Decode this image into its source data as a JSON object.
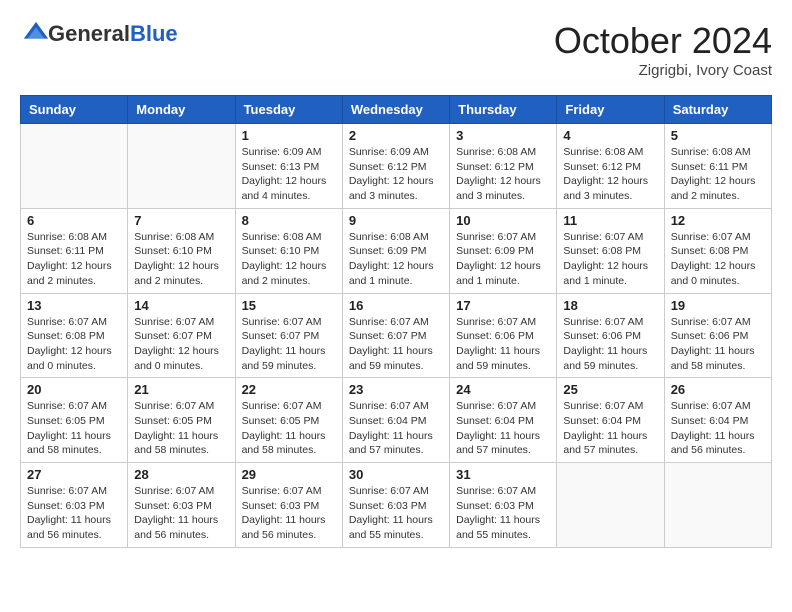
{
  "header": {
    "logo_general": "General",
    "logo_blue": "Blue",
    "month_title": "October 2024",
    "location": "Zigrigbi, Ivory Coast"
  },
  "days_of_week": [
    "Sunday",
    "Monday",
    "Tuesday",
    "Wednesday",
    "Thursday",
    "Friday",
    "Saturday"
  ],
  "weeks": [
    [
      {
        "day": "",
        "detail": ""
      },
      {
        "day": "",
        "detail": ""
      },
      {
        "day": "1",
        "detail": "Sunrise: 6:09 AM\nSunset: 6:13 PM\nDaylight: 12 hours and 4 minutes."
      },
      {
        "day": "2",
        "detail": "Sunrise: 6:09 AM\nSunset: 6:12 PM\nDaylight: 12 hours and 3 minutes."
      },
      {
        "day": "3",
        "detail": "Sunrise: 6:08 AM\nSunset: 6:12 PM\nDaylight: 12 hours and 3 minutes."
      },
      {
        "day": "4",
        "detail": "Sunrise: 6:08 AM\nSunset: 6:12 PM\nDaylight: 12 hours and 3 minutes."
      },
      {
        "day": "5",
        "detail": "Sunrise: 6:08 AM\nSunset: 6:11 PM\nDaylight: 12 hours and 2 minutes."
      }
    ],
    [
      {
        "day": "6",
        "detail": "Sunrise: 6:08 AM\nSunset: 6:11 PM\nDaylight: 12 hours and 2 minutes."
      },
      {
        "day": "7",
        "detail": "Sunrise: 6:08 AM\nSunset: 6:10 PM\nDaylight: 12 hours and 2 minutes."
      },
      {
        "day": "8",
        "detail": "Sunrise: 6:08 AM\nSunset: 6:10 PM\nDaylight: 12 hours and 2 minutes."
      },
      {
        "day": "9",
        "detail": "Sunrise: 6:08 AM\nSunset: 6:09 PM\nDaylight: 12 hours and 1 minute."
      },
      {
        "day": "10",
        "detail": "Sunrise: 6:07 AM\nSunset: 6:09 PM\nDaylight: 12 hours and 1 minute."
      },
      {
        "day": "11",
        "detail": "Sunrise: 6:07 AM\nSunset: 6:08 PM\nDaylight: 12 hours and 1 minute."
      },
      {
        "day": "12",
        "detail": "Sunrise: 6:07 AM\nSunset: 6:08 PM\nDaylight: 12 hours and 0 minutes."
      }
    ],
    [
      {
        "day": "13",
        "detail": "Sunrise: 6:07 AM\nSunset: 6:08 PM\nDaylight: 12 hours and 0 minutes."
      },
      {
        "day": "14",
        "detail": "Sunrise: 6:07 AM\nSunset: 6:07 PM\nDaylight: 12 hours and 0 minutes."
      },
      {
        "day": "15",
        "detail": "Sunrise: 6:07 AM\nSunset: 6:07 PM\nDaylight: 11 hours and 59 minutes."
      },
      {
        "day": "16",
        "detail": "Sunrise: 6:07 AM\nSunset: 6:07 PM\nDaylight: 11 hours and 59 minutes."
      },
      {
        "day": "17",
        "detail": "Sunrise: 6:07 AM\nSunset: 6:06 PM\nDaylight: 11 hours and 59 minutes."
      },
      {
        "day": "18",
        "detail": "Sunrise: 6:07 AM\nSunset: 6:06 PM\nDaylight: 11 hours and 59 minutes."
      },
      {
        "day": "19",
        "detail": "Sunrise: 6:07 AM\nSunset: 6:06 PM\nDaylight: 11 hours and 58 minutes."
      }
    ],
    [
      {
        "day": "20",
        "detail": "Sunrise: 6:07 AM\nSunset: 6:05 PM\nDaylight: 11 hours and 58 minutes."
      },
      {
        "day": "21",
        "detail": "Sunrise: 6:07 AM\nSunset: 6:05 PM\nDaylight: 11 hours and 58 minutes."
      },
      {
        "day": "22",
        "detail": "Sunrise: 6:07 AM\nSunset: 6:05 PM\nDaylight: 11 hours and 58 minutes."
      },
      {
        "day": "23",
        "detail": "Sunrise: 6:07 AM\nSunset: 6:04 PM\nDaylight: 11 hours and 57 minutes."
      },
      {
        "day": "24",
        "detail": "Sunrise: 6:07 AM\nSunset: 6:04 PM\nDaylight: 11 hours and 57 minutes."
      },
      {
        "day": "25",
        "detail": "Sunrise: 6:07 AM\nSunset: 6:04 PM\nDaylight: 11 hours and 57 minutes."
      },
      {
        "day": "26",
        "detail": "Sunrise: 6:07 AM\nSunset: 6:04 PM\nDaylight: 11 hours and 56 minutes."
      }
    ],
    [
      {
        "day": "27",
        "detail": "Sunrise: 6:07 AM\nSunset: 6:03 PM\nDaylight: 11 hours and 56 minutes."
      },
      {
        "day": "28",
        "detail": "Sunrise: 6:07 AM\nSunset: 6:03 PM\nDaylight: 11 hours and 56 minutes."
      },
      {
        "day": "29",
        "detail": "Sunrise: 6:07 AM\nSunset: 6:03 PM\nDaylight: 11 hours and 56 minutes."
      },
      {
        "day": "30",
        "detail": "Sunrise: 6:07 AM\nSunset: 6:03 PM\nDaylight: 11 hours and 55 minutes."
      },
      {
        "day": "31",
        "detail": "Sunrise: 6:07 AM\nSunset: 6:03 PM\nDaylight: 11 hours and 55 minutes."
      },
      {
        "day": "",
        "detail": ""
      },
      {
        "day": "",
        "detail": ""
      }
    ]
  ]
}
